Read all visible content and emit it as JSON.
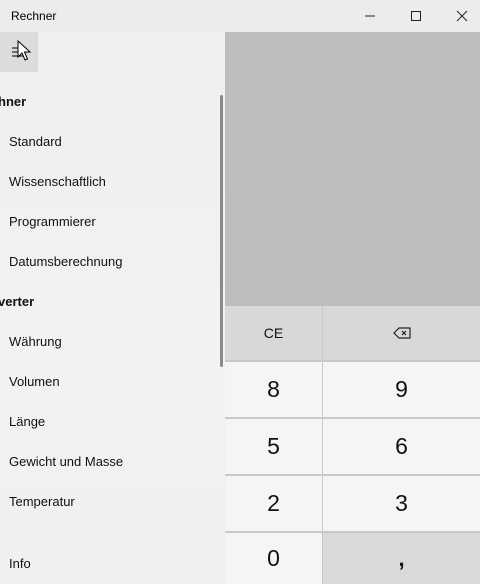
{
  "window": {
    "title": "Rechner",
    "controls": {
      "minimize": "—",
      "maximize": "☐",
      "close": "✕"
    }
  },
  "nav": {
    "sections": [
      {
        "label": "hner",
        "items": [
          "Standard",
          "Wissenschaftlich",
          "Programmierer",
          "Datumsberechnung"
        ]
      },
      {
        "label": "verter",
        "items": [
          "Währung",
          "Volumen",
          "Länge",
          "Gewicht und Masse",
          "Temperatur"
        ]
      }
    ],
    "footer_item": "Info"
  },
  "keypad": {
    "row1": [
      "CE",
      "⌫"
    ],
    "row2": [
      "8",
      "9"
    ],
    "row3": [
      "5",
      "6"
    ],
    "row4": [
      "2",
      "3"
    ],
    "row5": [
      "0",
      ","
    ]
  }
}
